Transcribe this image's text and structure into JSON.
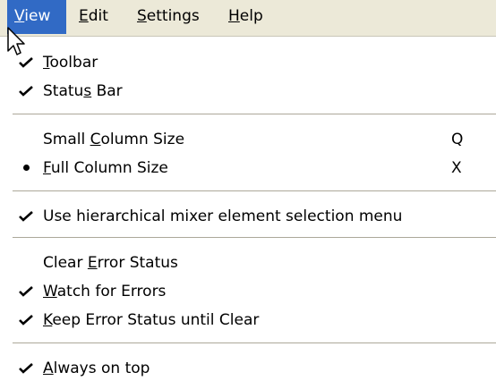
{
  "menubar": {
    "items": [
      {
        "label": "View",
        "mnemonic": "V",
        "active": true
      },
      {
        "label": "Edit",
        "mnemonic": "E",
        "active": false
      },
      {
        "label": "Settings",
        "mnemonic": "S",
        "active": false
      },
      {
        "label": "Help",
        "mnemonic": "H",
        "active": false
      }
    ]
  },
  "view_menu": {
    "items": [
      {
        "label": "Toolbar",
        "mnemonic_index": 0,
        "mark": "check",
        "shortcut": ""
      },
      {
        "label": "Status Bar",
        "mnemonic_index": 5,
        "mark": "check",
        "shortcut": ""
      },
      {
        "label": "Small Column Size",
        "mnemonic_index": 6,
        "mark": "none",
        "shortcut": "Q"
      },
      {
        "label": "Full Column Size",
        "mnemonic_index": 0,
        "mark": "bullet",
        "shortcut": "X"
      },
      {
        "label": "Use hierarchical mixer element selection menu",
        "mnemonic_index": -1,
        "mark": "check",
        "shortcut": ""
      },
      {
        "label": "Clear Error Status",
        "mnemonic_index": 6,
        "mark": "none",
        "shortcut": ""
      },
      {
        "label": "Watch for Errors",
        "mnemonic_index": 0,
        "mark": "check",
        "shortcut": ""
      },
      {
        "label": "Keep Error Status until Clear",
        "mnemonic_index": 0,
        "mark": "check",
        "shortcut": ""
      },
      {
        "label": "Always on top",
        "mnemonic_index": 0,
        "mark": "check",
        "shortcut": ""
      }
    ]
  },
  "colors": {
    "menubar_bg": "#ece9d8",
    "highlight": "#316ac5",
    "menu_bg": "#ffffff",
    "separator": "#aca899"
  },
  "icons": [
    "check-icon",
    "bullet-icon",
    "cursor-icon"
  ]
}
